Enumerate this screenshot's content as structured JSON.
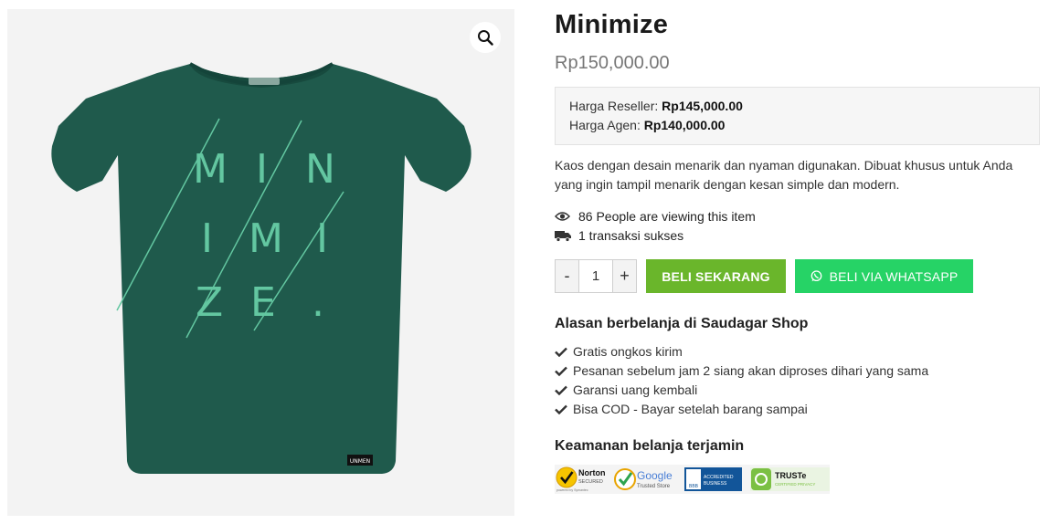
{
  "product": {
    "title": "Minimize",
    "price": "Rp150,000.00",
    "image": {
      "alt": "Kaos Minimize",
      "shirt_color": "#1f5a4c",
      "print_color": "#63c7a1",
      "print_letters": [
        "M",
        "I",
        "N",
        "I",
        "M",
        "I",
        "Z",
        "E",
        "."
      ],
      "tag_text": "UNMEN"
    },
    "tiers": [
      {
        "label": "Harga Reseller:",
        "value": "Rp145,000.00"
      },
      {
        "label": "Harga Agen:",
        "value": "Rp140,000.00"
      }
    ],
    "description": "Kaos dengan desain menarik dan nyaman digunakan. Dibuat khusus untuk Anda yang ingin tampil menarik dengan kesan simple dan modern.",
    "viewers": "86 People are viewing this item",
    "sales": "1 transaksi sukses"
  },
  "purchase": {
    "minus_label": "-",
    "plus_label": "+",
    "quantity": "1",
    "buy_now_label": "BELI SEKARANG",
    "whatsapp_label": "BELI VIA WHATSAPP",
    "buy_color": "#6ab62b",
    "whatsapp_color": "#26d366"
  },
  "reasons": {
    "title": "Alasan berbelanja di Saudagar Shop",
    "items": [
      "Gratis ongkos kirim",
      "Pesanan sebelum jam 2 siang akan diproses dihari yang sama",
      "Garansi uang kembali",
      "Bisa COD - Bayar setelah barang sampai"
    ]
  },
  "security": {
    "title": "Keamanan belanja terjamin",
    "badges": {
      "norton": {
        "line1": "Norton",
        "line2": "SECURED",
        "line3": "powered by Symantec"
      },
      "google": {
        "line1": "Google",
        "line2": "Trusted Store"
      },
      "bbb": {
        "mark": "BBB",
        "line1": "ACCREDITED",
        "line2": "BUSINESS"
      },
      "truste": {
        "line1": "TRUSTe",
        "line2": "CERTIFIED PRIVACY"
      }
    }
  },
  "icons": {
    "zoom": "magnifier-icon",
    "viewers": "eye-icon",
    "sales": "truck-icon",
    "whatsapp": "whatsapp-icon",
    "reason": "check-icon"
  }
}
